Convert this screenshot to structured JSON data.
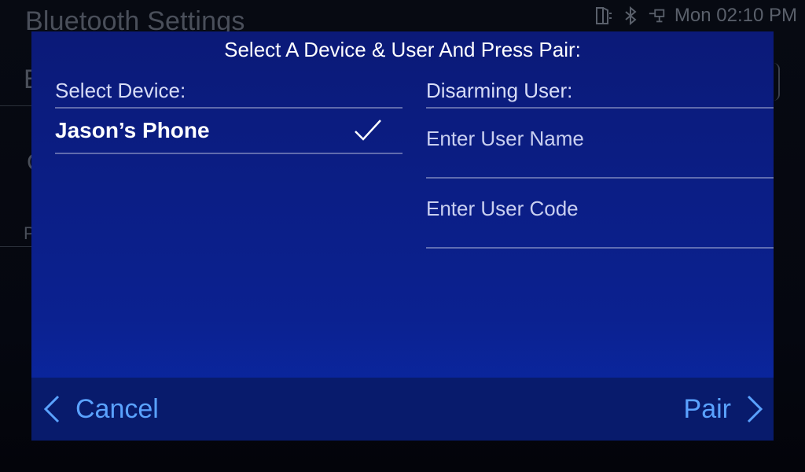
{
  "background": {
    "title": "Bluetooth Settings",
    "fragment_b": "B",
    "fragment_c": "C",
    "fragment_p": "P",
    "status": {
      "time": "Mon 02:10 PM",
      "icons": [
        "door-icon",
        "bluetooth-icon",
        "network-icon"
      ]
    }
  },
  "modal": {
    "title": "Select A Device & User And Press Pair:",
    "left": {
      "label": "Select Device:",
      "devices": [
        {
          "name": "Jason’s Phone",
          "selected": true
        }
      ]
    },
    "right": {
      "label": "Disarming User:",
      "user_name_placeholder": "Enter User Name",
      "user_code_placeholder": "Enter User Code"
    },
    "footer": {
      "cancel_label": "Cancel",
      "pair_label": "Pair"
    }
  },
  "colors": {
    "modal_bg": "#0b1f8c",
    "footer_bg": "#081b6c",
    "accent": "#5aa2ff"
  }
}
